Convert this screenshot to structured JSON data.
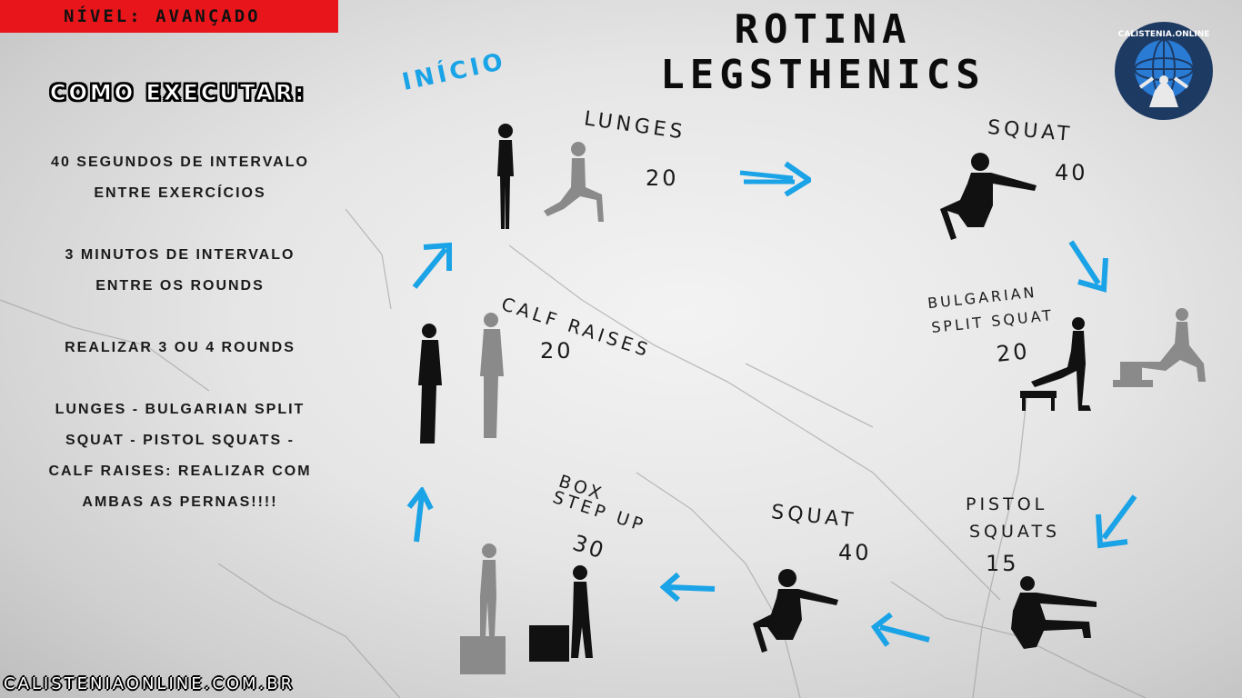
{
  "level": "NÍVEL: AVANÇADO",
  "title_line1": "ROTINA",
  "title_line2": "LEGSTHENICS",
  "how_to": {
    "title": "COMO EXECUTAR:",
    "items": [
      "40 SEGUNDOS DE INTERVALO\nENTRE EXERCÍCIOS",
      "3 MINUTOS DE INTERVALO\nENTRE OS ROUNDS",
      "REALIZAR 3 OU 4 ROUNDS",
      "LUNGES - BULGARIAN SPLIT\nSQUAT - PISTOL SQUATS -\nCALF RAISES: REALIZAR COM\nAMBAS AS PERNAS!!!!"
    ]
  },
  "start_label": "INÍCIO",
  "logo": {
    "text": "CALISTENIA.ONLINE",
    "color": "#1d3a63",
    "accent": "#2a7bd4",
    "icon": "globe-atlas-icon"
  },
  "exercises": [
    {
      "name": "LUNGES",
      "reps": "20"
    },
    {
      "name": "SQUAT",
      "reps": "40"
    },
    {
      "name_line1": "BULGARIAN",
      "name_line2": "SPLIT SQUAT",
      "reps": "20"
    },
    {
      "name_line1": "PISTOL",
      "name_line2": "SQUATS",
      "reps": "15"
    },
    {
      "name": "SQUAT",
      "reps": "40"
    },
    {
      "name_line1": "BOX",
      "name_line2": "STEP UP",
      "reps": "30"
    },
    {
      "name": "CALF RAISES",
      "reps": "20"
    }
  ],
  "footer": "CALISTENIAONLINE.COM.BR",
  "colors": {
    "arrow": "#1aa3e6",
    "badge": "#e8161b",
    "silhouette": "#111111",
    "silhouette_light": "#8a8a8a"
  }
}
